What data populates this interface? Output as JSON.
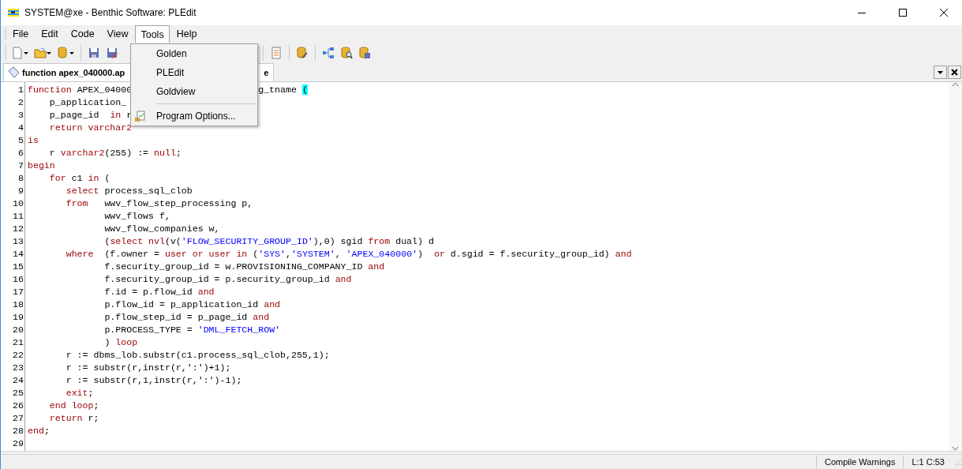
{
  "window": {
    "title": "SYSTEM@xe - Benthic Software: PLEdit"
  },
  "menu_bar": [
    {
      "label": "File",
      "selected": false
    },
    {
      "label": "Edit",
      "selected": false
    },
    {
      "label": "Code",
      "selected": false
    },
    {
      "label": "View",
      "selected": false
    },
    {
      "label": "Tools",
      "selected": true
    },
    {
      "label": "Help",
      "selected": false
    }
  ],
  "tools_menu": [
    {
      "kind": "item",
      "label": "Golden"
    },
    {
      "kind": "item",
      "label": "PLEdit"
    },
    {
      "kind": "item",
      "label": "Goldview"
    },
    {
      "kind": "separator"
    },
    {
      "kind": "item",
      "label": "Program Options..."
    }
  ],
  "tab": {
    "label_start": "function apex_040000.ap",
    "label_end": "e",
    "selected": true
  },
  "editor": {
    "lines": [
      {
        "number": "1",
        "tokens": [
          {
            "text": "function ",
            "kind": "keyword"
          },
          {
            "text": "APEX_04000",
            "kind": "plain"
          }
        ],
        "after_menu": [
          {
            "text": "g_tname ",
            "kind": "plain"
          },
          {
            "text": "(",
            "kind": "match"
          }
        ]
      },
      {
        "number": "2",
        "tokens": [
          {
            "text": "    p_application_",
            "kind": "plain"
          }
        ]
      },
      {
        "number": "3",
        "tokens": [
          {
            "text": "    p_page_id  ",
            "kind": "plain"
          },
          {
            "text": "in",
            "kind": "keyword"
          },
          {
            "text": " r",
            "kind": "plain"
          }
        ]
      },
      {
        "number": "4",
        "tokens": [
          {
            "text": "    return varchar2",
            "kind": "keyword"
          }
        ]
      },
      {
        "number": "5",
        "tokens": [
          {
            "text": "is",
            "kind": "keyword"
          }
        ]
      },
      {
        "number": "6",
        "tokens": [
          {
            "text": "    r ",
            "kind": "plain"
          },
          {
            "text": "varchar2",
            "kind": "keyword"
          },
          {
            "text": "(255) := ",
            "kind": "plain"
          },
          {
            "text": "null",
            "kind": "keyword"
          },
          {
            "text": ";",
            "kind": "plain"
          }
        ]
      },
      {
        "number": "7",
        "tokens": [
          {
            "text": "begin",
            "kind": "keyword"
          }
        ]
      },
      {
        "number": "8",
        "tokens": [
          {
            "text": "    for",
            "kind": "keyword"
          },
          {
            "text": " c1 ",
            "kind": "plain"
          },
          {
            "text": "in",
            "kind": "keyword"
          },
          {
            "text": " (",
            "kind": "plain"
          }
        ]
      },
      {
        "number": "9",
        "tokens": [
          {
            "text": "       select",
            "kind": "keyword"
          },
          {
            "text": " process_sql_clob",
            "kind": "plain"
          }
        ]
      },
      {
        "number": "10",
        "tokens": [
          {
            "text": "       from",
            "kind": "keyword"
          },
          {
            "text": "   wwv_flow_step_processing p,",
            "kind": "plain"
          }
        ]
      },
      {
        "number": "11",
        "tokens": [
          {
            "text": "              wwv_flows f,",
            "kind": "plain"
          }
        ]
      },
      {
        "number": "12",
        "tokens": [
          {
            "text": "              wwv_flow_companies w,",
            "kind": "plain"
          }
        ]
      },
      {
        "number": "13",
        "tokens": [
          {
            "text": "              (",
            "kind": "plain"
          },
          {
            "text": "select nvl",
            "kind": "keyword"
          },
          {
            "text": "(v(",
            "kind": "plain"
          },
          {
            "text": "'FLOW_SECURITY_GROUP_ID'",
            "kind": "string"
          },
          {
            "text": "),0) sgid ",
            "kind": "plain"
          },
          {
            "text": "from",
            "kind": "keyword"
          },
          {
            "text": " dual) d",
            "kind": "plain"
          }
        ]
      },
      {
        "number": "14",
        "tokens": [
          {
            "text": "       where",
            "kind": "keyword"
          },
          {
            "text": "  (f.owner = ",
            "kind": "plain"
          },
          {
            "text": "user or user in",
            "kind": "keyword"
          },
          {
            "text": " (",
            "kind": "plain"
          },
          {
            "text": "'SYS'",
            "kind": "string"
          },
          {
            "text": ",",
            "kind": "plain"
          },
          {
            "text": "'SYSTEM'",
            "kind": "string"
          },
          {
            "text": ", ",
            "kind": "plain"
          },
          {
            "text": "'APEX_040000'",
            "kind": "string"
          },
          {
            "text": ")  ",
            "kind": "plain"
          },
          {
            "text": "or",
            "kind": "keyword"
          },
          {
            "text": " d.sgid = f.security_group_id) ",
            "kind": "plain"
          },
          {
            "text": "and",
            "kind": "keyword"
          }
        ]
      },
      {
        "number": "15",
        "tokens": [
          {
            "text": "              f.security_group_id = w.PROVISIONING_COMPANY_ID ",
            "kind": "plain"
          },
          {
            "text": "and",
            "kind": "keyword"
          }
        ]
      },
      {
        "number": "16",
        "tokens": [
          {
            "text": "              f.security_group_id = p.security_group_id ",
            "kind": "plain"
          },
          {
            "text": "and",
            "kind": "keyword"
          }
        ]
      },
      {
        "number": "17",
        "tokens": [
          {
            "text": "              f.id = p.flow_id ",
            "kind": "plain"
          },
          {
            "text": "and",
            "kind": "keyword"
          }
        ]
      },
      {
        "number": "18",
        "tokens": [
          {
            "text": "              p.flow_id = p_application_id ",
            "kind": "plain"
          },
          {
            "text": "and",
            "kind": "keyword"
          }
        ]
      },
      {
        "number": "19",
        "tokens": [
          {
            "text": "              p.flow_step_id = p_page_id ",
            "kind": "plain"
          },
          {
            "text": "and",
            "kind": "keyword"
          }
        ]
      },
      {
        "number": "20",
        "tokens": [
          {
            "text": "              p.PROCESS_TYPE = ",
            "kind": "plain"
          },
          {
            "text": "'DML_FETCH_ROW'",
            "kind": "string"
          }
        ]
      },
      {
        "number": "21",
        "tokens": [
          {
            "text": "              ) ",
            "kind": "plain"
          },
          {
            "text": "loop",
            "kind": "keyword"
          }
        ]
      },
      {
        "number": "22",
        "tokens": [
          {
            "text": "       r := dbms_lob.substr(c1.process_sql_clob,255,1);",
            "kind": "plain"
          }
        ]
      },
      {
        "number": "23",
        "tokens": [
          {
            "text": "       r := substr(r,instr(r,':')+1);",
            "kind": "plain"
          }
        ]
      },
      {
        "number": "24",
        "tokens": [
          {
            "text": "       r := substr(r,1,instr(r,':')-1);",
            "kind": "plain"
          }
        ]
      },
      {
        "number": "25",
        "tokens": [
          {
            "text": "       exit",
            "kind": "keyword"
          },
          {
            "text": ";",
            "kind": "plain"
          }
        ]
      },
      {
        "number": "26",
        "tokens": [
          {
            "text": "    end loop",
            "kind": "keyword"
          },
          {
            "text": ";",
            "kind": "plain"
          }
        ]
      },
      {
        "number": "27",
        "tokens": [
          {
            "text": "    return",
            "kind": "keyword"
          },
          {
            "text": " r;",
            "kind": "plain"
          }
        ]
      },
      {
        "number": "28",
        "tokens": [
          {
            "text": "end",
            "kind": "keyword"
          },
          {
            "text": ";",
            "kind": "plain"
          }
        ]
      },
      {
        "number": "29"
      }
    ]
  },
  "status_bar": {
    "warnings": "Compile Warnings",
    "position": "L:1 C:53"
  }
}
